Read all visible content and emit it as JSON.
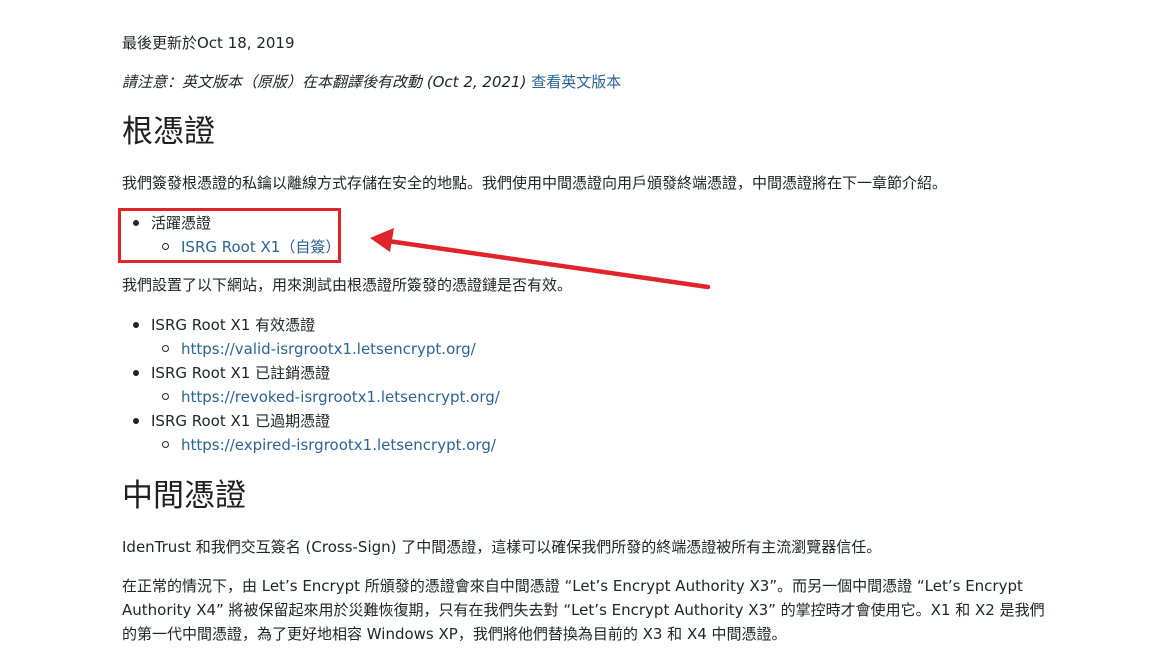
{
  "page": {
    "last_updated": "最後更新於Oct 18, 2019",
    "notice_text": "請注意：英文版本（原版）在本翻譯後有改動 (Oct 2, 2021) ",
    "notice_link": "查看英文版本"
  },
  "root_section": {
    "heading": "根憑證",
    "intro": "我們簽發根憑證的私鑰以離線方式存儲在安全的地點。我們使用中間憑證向用戶頒發終端憑證，中間憑證將在下一章節介紹。",
    "active_label": "活躍憑證",
    "active_cert": "ISRG Root X1（自簽）",
    "test_intro": "我們設置了以下網站，用來測試由根憑證所簽發的憑證鏈是否有效。",
    "test_items": [
      {
        "label": "ISRG Root X1 有效憑證",
        "url": "https://valid-isrgrootx1.letsencrypt.org/"
      },
      {
        "label": "ISRG Root X1 已註銷憑證",
        "url": "https://revoked-isrgrootx1.letsencrypt.org/"
      },
      {
        "label": "ISRG Root X1 已過期憑證",
        "url": "https://expired-isrgrootx1.letsencrypt.org/"
      }
    ]
  },
  "intermediate_section": {
    "heading": "中間憑證",
    "cross_sign": "IdenTrust 和我們交互簽名 (Cross-Sign) 了中間憑證，這樣可以確保我們所發的終端憑證被所有主流瀏覽器信任。",
    "normal": "在正常的情況下，由 Let’s Encrypt 所頒發的憑證會來自中間憑證 “Let’s Encrypt Authority X3”。而另一個中間憑證 “Let’s Encrypt Authority X4” 將被保留起來用於災難恢復期，只有在我們失去對 “Let’s Encrypt Authority X3” 的掌控時才會使用它。X1 和 X2 是我們的第一代中間憑證，為了更好地相容 Windows XP，我們將他們替換為目前的 X3 和 X4 中間憑證。"
  },
  "annotation_color": "#e0242a",
  "link_color": "#2a6496"
}
